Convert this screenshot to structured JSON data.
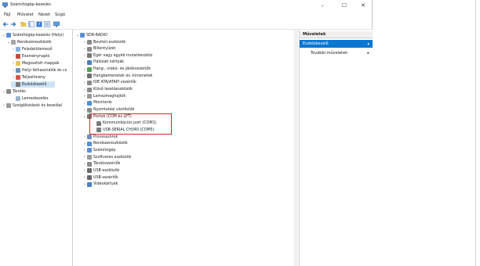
{
  "window": {
    "title": "Számítógép-kezelés",
    "controls": {
      "minimize": "–",
      "maximize": "☐",
      "close": "✕"
    }
  },
  "menu": [
    {
      "label": "Fájl"
    },
    {
      "label": "Művelet"
    },
    {
      "label": "Nézet"
    },
    {
      "label": "Súgó"
    }
  ],
  "left_tree": [
    {
      "label": "Számítógép-kezelés (Helyi)",
      "icon": "computer-icon"
    },
    {
      "label": "Rendszereszközök",
      "icon": "tools-icon"
    },
    {
      "label": "Feladatütemező",
      "icon": "clock-icon"
    },
    {
      "label": "Eseménynapló",
      "icon": "log-icon"
    },
    {
      "label": "Megosztott mappák",
      "icon": "folder-icon"
    },
    {
      "label": "Helyi felhasználók és cs",
      "icon": "users-icon"
    },
    {
      "label": "Teljesítmény",
      "icon": "gauge-icon"
    },
    {
      "label": "Eszközkezelő",
      "icon": "device-icon"
    },
    {
      "label": "Tárolás",
      "icon": "storage-icon"
    },
    {
      "label": "Lemezkezelés",
      "icon": "disk-icon"
    },
    {
      "label": "Szolgáltatások és kezelőal",
      "icon": "services-icon"
    }
  ],
  "device_tree": {
    "root": "SDR-RADIO",
    "items": [
      {
        "label": "Beviteli eszközök"
      },
      {
        "label": "Billentyűzet"
      },
      {
        "label": "Egér vagy egyéb mutatóeszköz"
      },
      {
        "label": "Hálózati kártyák"
      },
      {
        "label": "Hang-, videó- és játékvezérlők"
      },
      {
        "label": "Hangbemenetek és -kimenetek"
      },
      {
        "label": "IDE ATA/ATAPI vezérlők"
      },
      {
        "label": "Külső lezelőeszközök"
      },
      {
        "label": "Lemezmeghajtók"
      },
      {
        "label": "Monitorok"
      },
      {
        "label": "Nyomtatási várólisták"
      },
      {
        "label": "Portok (COM és LPT)"
      },
      {
        "label": "Kommunikációs port (COM1)"
      },
      {
        "label": "USB-SERIAL CH340 (COM5)"
      },
      {
        "label": "Processzorok"
      },
      {
        "label": "Rendszereszközök"
      },
      {
        "label": "Számítógép"
      },
      {
        "label": "Szoftveres eszközök"
      },
      {
        "label": "Tárolóvezérlők"
      },
      {
        "label": "USB-eszközök"
      },
      {
        "label": "USB-vezérlők"
      },
      {
        "label": "Videokártyák"
      }
    ]
  },
  "actions": {
    "header": "Műveletek",
    "selected": "Eszközkezelő",
    "more": "További műveletek"
  },
  "colors": {
    "highlight_box": "#e0202a",
    "selection": "#0a77d2"
  }
}
